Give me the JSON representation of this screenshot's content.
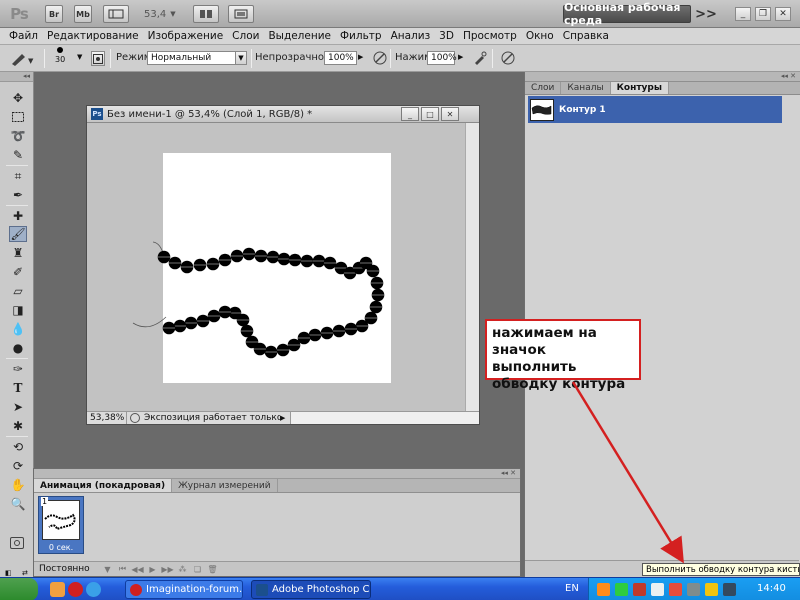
{
  "app": {
    "logo": "Ps",
    "bridge": "Br",
    "minibridge": "Mb",
    "zoom": "53,4",
    "workspace": "Основная рабочая среда",
    "more": ">>"
  },
  "menu": [
    "Файл",
    "Редактирование",
    "Изображение",
    "Слои",
    "Выделение",
    "Фильтр",
    "Анализ",
    "3D",
    "Просмотр",
    "Окно",
    "Справка"
  ],
  "options": {
    "brush_size": "30",
    "mode_label": "Режим:",
    "mode_value": "Нормальный",
    "opacity_label": "Непрозрачность:",
    "opacity_value": "100%",
    "pressure_label": "Нажим:",
    "pressure_value": "100%"
  },
  "document": {
    "title": "Без имени-1 @ 53,4% (Слой 1, RGB/8) *",
    "status_zoom": "53,38%",
    "status_info": "Экспозиция работает только в ..."
  },
  "animation_panel": {
    "tabs": [
      "Анимация (покадровая)",
      "Журнал измерений"
    ],
    "frame_number": "1",
    "frame_delay": "0 сек.",
    "loop": "Постоянно"
  },
  "right_panel": {
    "tabs": [
      "Слои",
      "Каналы",
      "Контуры"
    ],
    "path_name": "Контур 1",
    "tooltip": "Выполнить обводку контура кистью"
  },
  "annotation": {
    "text": "нажимаем на значок выполнить обводку контура",
    "color": "#d42020"
  },
  "taskbar": {
    "tasks": [
      "Imagination-forum.co...",
      "Adobe Photoshop CS..."
    ],
    "language": "EN",
    "clock": "14:40"
  }
}
